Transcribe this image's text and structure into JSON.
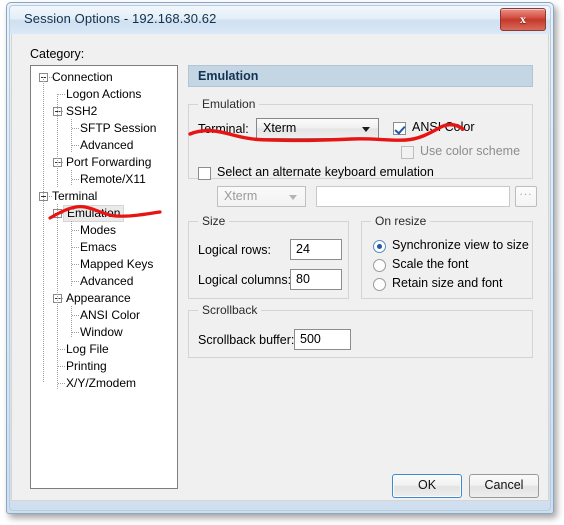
{
  "window": {
    "title": "Session Options - 192.168.30.62",
    "close_label": "x"
  },
  "sidebar": {
    "caption": "Category:",
    "items": [
      {
        "label": "Connection",
        "level": 0,
        "expander": true,
        "selected": false
      },
      {
        "label": "Logon Actions",
        "level": 1,
        "expander": false,
        "selected": false
      },
      {
        "label": "SSH2",
        "level": 1,
        "expander": true,
        "selected": false
      },
      {
        "label": "SFTP Session",
        "level": 2,
        "expander": false,
        "selected": false
      },
      {
        "label": "Advanced",
        "level": 2,
        "expander": false,
        "selected": false
      },
      {
        "label": "Port Forwarding",
        "level": 1,
        "expander": true,
        "selected": false
      },
      {
        "label": "Remote/X11",
        "level": 2,
        "expander": false,
        "selected": false
      },
      {
        "label": "Terminal",
        "level": 0,
        "expander": true,
        "selected": false
      },
      {
        "label": "Emulation",
        "level": 1,
        "expander": true,
        "selected": true
      },
      {
        "label": "Modes",
        "level": 2,
        "expander": false,
        "selected": false
      },
      {
        "label": "Emacs",
        "level": 2,
        "expander": false,
        "selected": false
      },
      {
        "label": "Mapped Keys",
        "level": 2,
        "expander": false,
        "selected": false
      },
      {
        "label": "Advanced",
        "level": 2,
        "expander": false,
        "selected": false
      },
      {
        "label": "Appearance",
        "level": 1,
        "expander": true,
        "selected": false
      },
      {
        "label": "ANSI Color",
        "level": 2,
        "expander": false,
        "selected": false
      },
      {
        "label": "Window",
        "level": 2,
        "expander": false,
        "selected": false
      },
      {
        "label": "Log File",
        "level": 1,
        "expander": false,
        "selected": false
      },
      {
        "label": "Printing",
        "level": 1,
        "expander": false,
        "selected": false
      },
      {
        "label": "X/Y/Zmodem",
        "level": 1,
        "expander": false,
        "selected": false
      }
    ]
  },
  "pane": {
    "header": "Emulation",
    "emulation_group": {
      "title": "Emulation",
      "terminal_label": "Terminal:",
      "terminal_value": "Xterm",
      "ansi_color_label": "ANSI Color",
      "ansi_color_checked": true,
      "use_color_scheme_label": "Use color scheme",
      "use_color_scheme_checked": false,
      "alt_keyboard_label": "Select an alternate keyboard emulation",
      "alt_keyboard_checked": false,
      "alt_keyboard_value": "Xterm",
      "alt_keyboard_path": "",
      "browse_label": "..."
    },
    "size_group": {
      "title": "Size",
      "rows_label": "Logical rows:",
      "rows_value": "24",
      "cols_label": "Logical columns:",
      "cols_value": "80"
    },
    "resize_group": {
      "title": "On resize",
      "options": [
        {
          "label": "Synchronize view to size",
          "selected": true
        },
        {
          "label": "Scale the font",
          "selected": false
        },
        {
          "label": "Retain size and font",
          "selected": false
        }
      ]
    },
    "scrollback_group": {
      "title": "Scrollback",
      "buffer_label": "Scrollback buffer:",
      "buffer_value": "500"
    }
  },
  "footer": {
    "ok_label": "OK",
    "cancel_label": "Cancel"
  },
  "annotations": {
    "color": "#e81414",
    "marks": [
      {
        "name": "underline-emulation-tree"
      },
      {
        "name": "underline-terminal-row"
      }
    ]
  }
}
